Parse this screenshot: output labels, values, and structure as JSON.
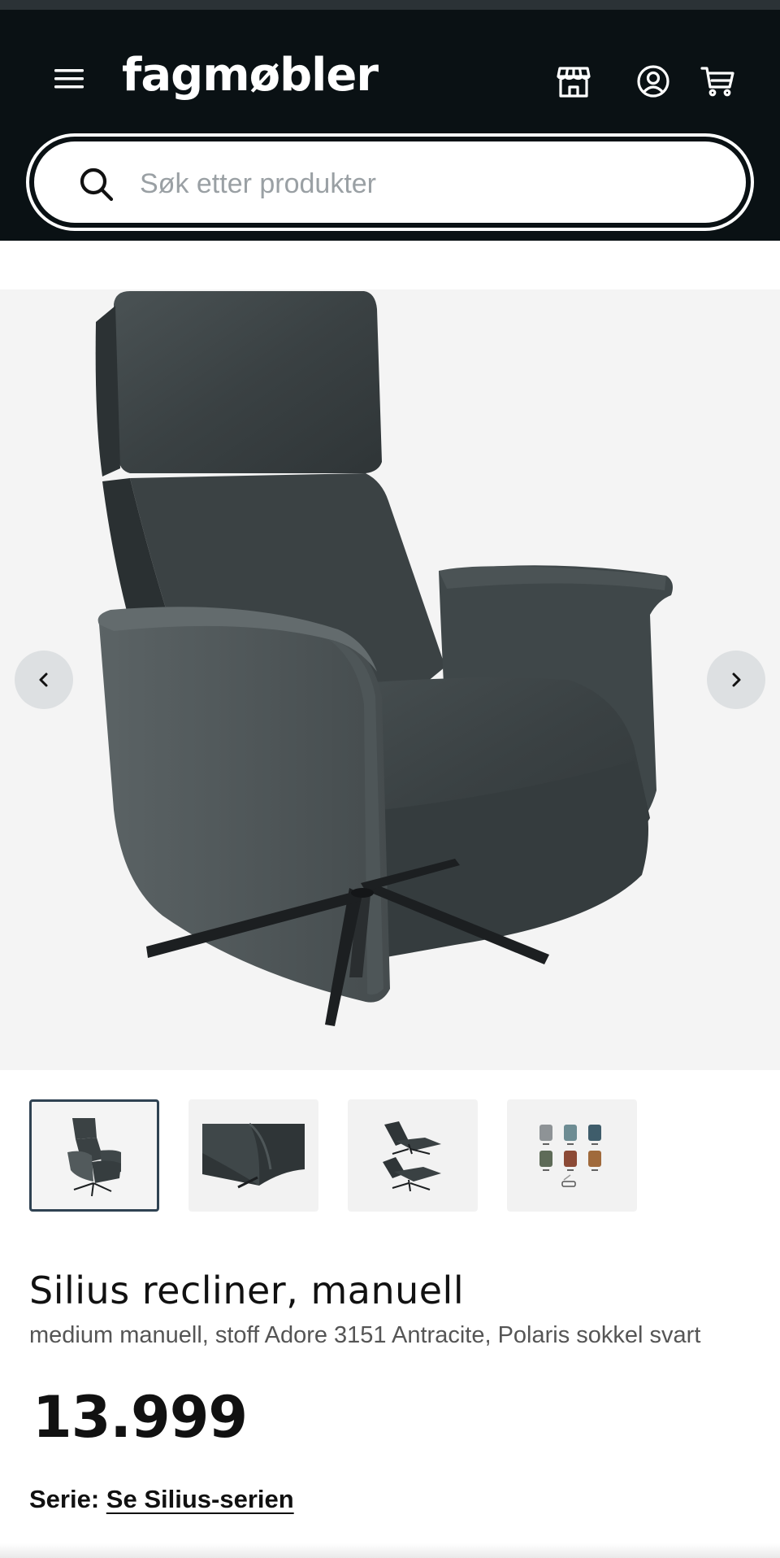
{
  "header": {
    "logo": "fagmøbler",
    "icons": [
      "menu-icon",
      "store-icon",
      "account-icon",
      "cart-icon"
    ],
    "background": "#0a1114"
  },
  "search": {
    "placeholder": "Søk etter produkter",
    "value": ""
  },
  "gallery": {
    "images_shown": 4,
    "active_index": 0,
    "thumbnails": [
      "chair-front",
      "chair-detail",
      "chair-recline-positions",
      "color-variants"
    ]
  },
  "product": {
    "title": "Silius recliner, manuell",
    "subtitle": "medium manuell, stoff Adore 3151 Antracite, Polaris sokkel svart",
    "price": "13.999",
    "series_label": "Serie:",
    "series_link": "Se Silius-serien"
  },
  "colors": {
    "fabric": "#3f4648",
    "active_border": "#2f4252",
    "nav_button": "#dde0e2"
  }
}
